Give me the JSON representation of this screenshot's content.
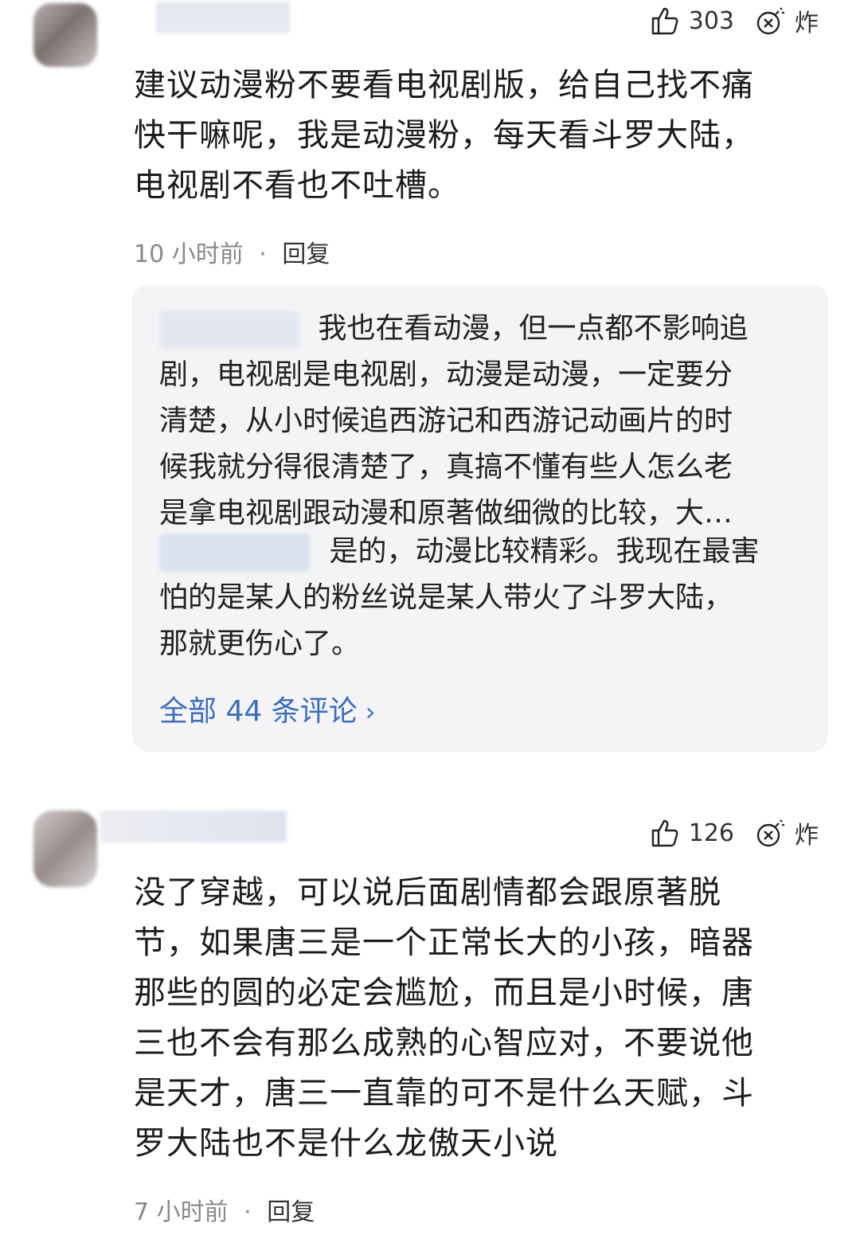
{
  "comments": [
    {
      "likes": "303",
      "bomb_label": "炸",
      "lines": [
        "建议动漫粉不要看电视剧版，给自己找不痛",
        "快干嘛呢，我是动漫粉，每天看斗罗大陆，",
        "电视剧不看也不吐槽。"
      ],
      "time": "10 小时前",
      "separator": "·",
      "reply_label": "回复",
      "replies": [
        {
          "lines": [
            "我也在看动漫，但一点都不影响追",
            "剧，电视剧是电视剧，动漫是动漫，一定要分",
            "清楚，从小时候追西游记和西游记动画片的时",
            "候我就分得很清楚了，真搞不懂有些人怎么老",
            "是拿电视剧跟动漫和原著做细微的比较，大…"
          ]
        },
        {
          "lines": [
            "是的，动漫比较精彩。我现在最害",
            "怕的是某人的粉丝说是某人带火了斗罗大陆，",
            "那就更伤心了。"
          ]
        }
      ],
      "all_comments_label": "全部 44 条评论",
      "chevron": "›"
    },
    {
      "likes": "126",
      "bomb_label": "炸",
      "lines": [
        "没了穿越，可以说后面剧情都会跟原著脱",
        "节，如果唐三是一个正常长大的小孩，暗器",
        "那些的圆的必定会尴尬，而且是小时候，唐",
        "三也不会有那么成熟的心智应对，不要说他",
        "是天才，唐三一直靠的可不是什么天赋，斗",
        "罗大陆也不是什么龙傲天小说"
      ],
      "time": "7 小时前",
      "separator": "·",
      "reply_label": "回复"
    }
  ],
  "icons": {
    "like": "thumbs-up-icon",
    "bomb": "bomb-icon"
  },
  "colors": {
    "link": "#3c6fb8",
    "reply_bg": "#f4f4f6",
    "meta": "#888888"
  }
}
